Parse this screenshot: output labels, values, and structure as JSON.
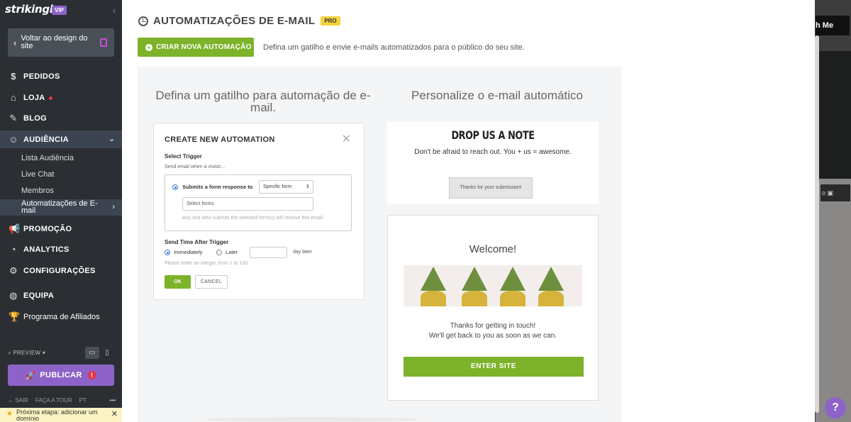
{
  "sidebar": {
    "logo": "strikingly",
    "vip_badge": "VIP",
    "back_button": "Voltar ao design do site",
    "nav": {
      "pedidos": "PEDIDOS",
      "loja": "LOJA",
      "blog": "BLOG",
      "audiencia": "AUDIÊNCIA",
      "promocao": "PROMOÇÃO",
      "analytics": "ANALYTICS",
      "configuracoes": "CONFIGURAÇÕES",
      "equipa": "EQUIPA",
      "afiliados": "Programa de Afiliados"
    },
    "audiencia_sub": {
      "lista": "Lista Audiência",
      "live_chat": "Live Chat",
      "membros": "Membros",
      "automatizacoes": "Automatizações de E-mail"
    },
    "preview": "PREVIEW",
    "publish": "PUBLICAR",
    "bottom": {
      "sair": "SAIR",
      "tour": "FAÇA A TOUR",
      "lang": "PT",
      "more": "•••"
    },
    "next_step": "Próxima etapa: adicionar um domínio"
  },
  "header": {
    "title": "AUTOMATIZAÇÕES DE E-MAIL",
    "pro_badge": "PRO",
    "create_button": "CRIAR NOVA AUTOMAÇÃO",
    "intro": "Defina um gatilho e envie e-mails automatizados para o público do seu site."
  },
  "left_column": {
    "heading": "Defina um gatilho para automação de e-mail.",
    "dialog": {
      "title": "CREATE NEW AUTOMATION",
      "select_trigger": "Select Trigger",
      "send_when": "Send email when a visitor...",
      "option": "Submits a form response to",
      "form_select": "Specific form",
      "forms_placeholder": "Select forms",
      "forms_hint": "Any one who submits the selected form(s) will receive this email.",
      "send_time": "Send Time After Trigger",
      "immediately": "Immediately",
      "later": "Later",
      "day_later": "day later",
      "integer_hint": "Please enter an integer, from 1 to 100.",
      "ok": "OK",
      "cancel": "CANCEL"
    }
  },
  "right_column": {
    "heading": "Personalize o e-mail automático",
    "note": {
      "title": "DROP US A NOTE",
      "subtitle": "Don't be afraid to reach out. You + us = awesome.",
      "thanks_button": "Thanks for your submission!"
    },
    "welcome": {
      "title": "Welcome!",
      "line1": "Thanks for getting in touch!",
      "line2": "We'll get back to you as soon as we can.",
      "enter": "ENTER SITE"
    }
  },
  "background": {
    "top_button": "h Me"
  },
  "help": "?",
  "colors": {
    "accent_green": "#7cb32a",
    "purple": "#8d63c9",
    "sidebar": "#2b2f33"
  }
}
